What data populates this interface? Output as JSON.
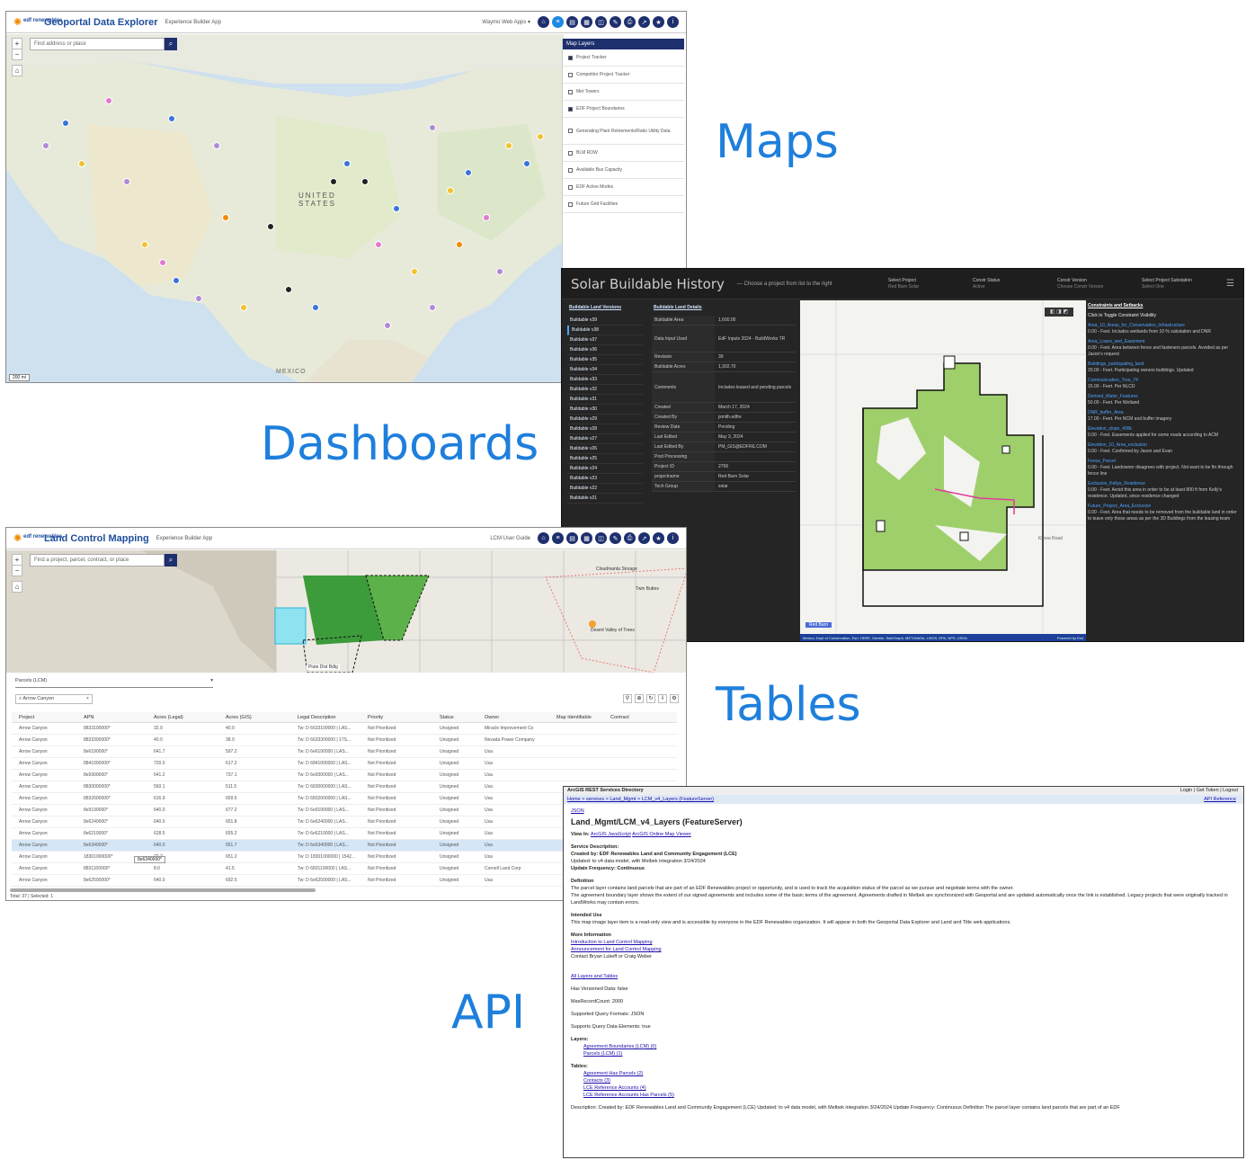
{
  "captions": {
    "maps": "Maps",
    "dashboards": "Dashboards",
    "tables": "Tables",
    "api": "API"
  },
  "geoportal": {
    "logo": "edf renewables",
    "title": "Geoportal Data Explorer",
    "subtitle": "Experience Builder App",
    "header_link": "Waymo Web Apps ▾",
    "search_placeholder": "Find address or place",
    "layers_title": "Map Layers",
    "layers": [
      "Project Tracker",
      "Competitor Project Tracker",
      "Met Towers",
      "EDF Project Boundaries",
      "Generating Plant Retirements/Ratio Utility Data",
      "BLM ROW",
      "Available Bus Capacity",
      "EDF Active Modes",
      "Future Grid Facilities"
    ],
    "scale": "200 mi"
  },
  "dashboard": {
    "title": "Solar Buildable History",
    "subtitle": "— Choose a project from list to the right",
    "selectors": [
      {
        "label": "Select Project",
        "value": "Red Barn Solar"
      },
      {
        "label": "Constr Status",
        "value": "Active"
      },
      {
        "label": "Constr Version",
        "value": "Choose Constr Version"
      },
      {
        "label": "Select Project Substation",
        "value": "Select One"
      }
    ],
    "list_header": "Buildable Land Versions",
    "versions": [
      "Buildable v39",
      "Buildable v38",
      "Buildable v37",
      "Buildable v36",
      "Buildable v35",
      "Buildable v34",
      "Buildable v33",
      "Buildable v32",
      "Buildable v31",
      "Buildable v30",
      "Buildable v29",
      "Buildable v28",
      "Buildable v27",
      "Buildable v26",
      "Buildable v25",
      "Buildable v24",
      "Buildable v23",
      "Buildable v22",
      "Buildable v21"
    ],
    "details_header": "Buildable Land Details",
    "details": [
      {
        "k": "Buildable Area",
        "v": "1,600.00"
      },
      {
        "k": "Data Input Used",
        "v": "EdF Inputs 2024 - BuildWorks TR"
      },
      {
        "k": "Revision",
        "v": "39"
      },
      {
        "k": "Buildable Acres",
        "v": "1,302.70"
      },
      {
        "k": "Comments",
        "v": "Includes leased and pending parcels"
      },
      {
        "k": "Created",
        "v": "March 17, 2024"
      },
      {
        "k": "Created By",
        "v": "jsmith.edfre"
      },
      {
        "k": "Review Date",
        "v": "Pending"
      },
      {
        "k": "Last Edited",
        "v": "May 3, 2024"
      },
      {
        "k": "Last Edited By",
        "v": "PM_GIS@EDFRE.COM"
      },
      {
        "k": "Post Processing",
        "v": ""
      },
      {
        "k": "Project ID",
        "v": "2796"
      },
      {
        "k": "projectname",
        "v": "Red Barn Solar"
      },
      {
        "k": "Tech Group",
        "v": "solar"
      }
    ],
    "constraints_header": "Constraints and Setbacks",
    "constraints_hint": "Click to Toggle Constraint Visibility",
    "constraints": [
      {
        "name": "Area_10_Areas_for_Conservation_Infrastructure",
        "note": "0.00 - Feet. Includes wetlands from 10 % substation and DNR"
      },
      {
        "name": "Area_Loans_and_Easement",
        "note": "0.00 - Feet. Area between fence and fasteners parcels. Avoided as per Jason's request"
      },
      {
        "name": "Buildings_participating_land",
        "note": "20.00 - Feet. Participating owners buildings. Updated"
      },
      {
        "name": "Communication_Tree_74",
        "note": "15.00 - Feet. Per NLCD"
      },
      {
        "name": "Derived_Water_Features",
        "note": "50.00 - Feet. Per Wetland"
      },
      {
        "name": "DNR_buffer_Area",
        "note": "17.00 - Feet. Per NCM and buffer imagery"
      },
      {
        "name": "Elevation_slope_400k",
        "note": "0.00 - Feet. Easements applied for some roads according to ACM"
      },
      {
        "name": "Elevation_10_Area_exclusion",
        "note": "0.00 - Feet. Confirmed by Jason and Evan"
      },
      {
        "name": "Fence_Parcel",
        "note": "0.00 - Feet. Landowner disagrees with project. Not want to be fin through fence line"
      },
      {
        "name": "Exclusion_Kellys_Residence",
        "note": "0.00 - Feet. Avoid this area in order to be at least 800 ft from Kelly's residence. Updated, since residence changed"
      },
      {
        "name": "Future_Project_Area_Exclusion",
        "note": "0.00 - Feet. Area that needs to be removed from the buildable land in order to leave only those areas as per the 3D Buildings from the leasing team"
      }
    ],
    "attribution": "Mexico, Dept of Conservation, Esri, HERE, Garmin, SafeGraph, METI/NASA, USGS, EPA, NPS, USDA",
    "powered": "Powered by Esri",
    "map_label_left": "Red Barn",
    "map_label_right": "Kiowa Road"
  },
  "lcm": {
    "logo": "edf renewables",
    "title": "Land Control Mapping",
    "subtitle": "Experience Builder App",
    "header_link": "LCM User Guide",
    "search_placeholder": "Find a project, parcel, contract, or place",
    "map_labels": [
      "Cloudmanta Storage",
      "Twin Buttes",
      "Desert Valley of Trees",
      "Piute Dist Bdlg"
    ],
    "layer_select": "Parcels (LCM)",
    "filter": "Arrow Canyon",
    "columns": [
      "Project",
      "APN",
      "Acres (Legal)",
      "Acres (GIS)",
      "Legal Description",
      "Priority",
      "Status",
      "Owner",
      "Map Identifiable",
      "Contract"
    ],
    "rows": [
      [
        "Arrow Canyon",
        "8833100000*",
        "32.9",
        "40.0",
        "Tw: D 6633100000 | LAS...",
        "Not Prioritized",
        "Unsigned",
        "Miracle Improvement Co",
        ""
      ],
      [
        "Arrow Canyon",
        "8833300000*",
        "40.0",
        "38.0",
        "Tw: D 6633300000 | 17S...",
        "Not Prioritized",
        "Unsigned",
        "Nevada Power Company",
        ""
      ],
      [
        "Arrow Canyon",
        "8e6190000*",
        "641.7",
        "597.2",
        "Tw: D 6e6190000 | LAS...",
        "Not Prioritized",
        "Unsigned",
        "Usa",
        ""
      ],
      [
        "Arrow Canyon",
        "8841000000*",
        "720.0",
        "617.2",
        "Tw: D 6841000000 | LAS...",
        "Not Prioritized",
        "Unsigned",
        "Usa",
        ""
      ],
      [
        "Arrow Canyon",
        "8e9300000*",
        "641.2",
        "737.1",
        "Tw: D 6e9300000 | LAS...",
        "Not Prioritized",
        "Unsigned",
        "Usa",
        ""
      ],
      [
        "Arrow Canyon",
        "8830000000*",
        "560.1",
        "511.5",
        "Tw: D 6830000000 | LAS...",
        "Not Prioritized",
        "Unsigned",
        "Usa",
        ""
      ],
      [
        "Arrow Canyon",
        "8832000000*",
        "616.9",
        "659.5",
        "Tw: D 6832000000 | LAS...",
        "Not Prioritized",
        "Unsigned",
        "Usa",
        ""
      ],
      [
        "Arrow Canyon",
        "8e9190000*",
        "640.0",
        "677.2",
        "Tw: D 6e9190000 | LAS...",
        "Not Prioritized",
        "Unsigned",
        "Usa",
        ""
      ],
      [
        "Arrow Canyon",
        "8e6240000*",
        "640.0",
        "651.8",
        "Tw: D 6e6240000 | LAS...",
        "Not Prioritized",
        "Unsigned",
        "Usa",
        ""
      ],
      [
        "Arrow Canyon",
        "8e6210000*",
        "628.5",
        "655.2",
        "Tw: D 6e6210000 | LAS...",
        "Not Prioritized",
        "Unsigned",
        "Usa",
        ""
      ],
      [
        "Arrow Canyon",
        "8e6340000*",
        "640.0",
        "651.7",
        "Tw: D 6e6340000 | LAS...",
        "Not Prioritized",
        "Unsigned",
        "Usa",
        ""
      ],
      [
        "Arrow Canyon",
        "18301000000*",
        "72.2",
        "651.2",
        "Tw: D 18301000000 | 1542...",
        "Not Prioritized",
        "Unsigned",
        "Usa",
        ""
      ],
      [
        "Arrow Canyon",
        "8831100000*",
        "8.0",
        "41.5",
        "Tw: D 6831100000 | LAS...",
        "Not Prioritized",
        "Unsigned",
        "Cornell Land Corp",
        ""
      ],
      [
        "Arrow Canyon",
        "8e62500000*",
        "640.0",
        "692.5",
        "Tw: D 6e62500000 | LAS...",
        "Not Prioritized",
        "Unsigned",
        "Usa",
        ""
      ]
    ],
    "tooltip": "8e6340000*",
    "footer": "Total: 37 | Selected: 1"
  },
  "api": {
    "header": "ArcGIS REST Services Directory",
    "login": "Login | Get Token | Logout",
    "breadcrumb": "Home > services > Land_Mgmt > LCM_v4_Layers (FeatureServer)",
    "api_ref": "API Reference",
    "json_link": "JSON",
    "title": "Land_Mgmt/LCM_v4_Layers (FeatureServer)",
    "view_in": "View In:",
    "view_links": [
      "ArcGIS JavaScript",
      "ArcGIS Online Map Viewer"
    ],
    "service_desc_label": "Service Description:",
    "created_by": "Created by: EDF Renewables Land and Community Engagement (LCE)",
    "updated": "Updated: to v4 data model, with Melbek integration 3/24/2024",
    "frequency": "Update Frequency: Continuous",
    "definition_label": "Definition",
    "definition": "The parcel layer contains land parcels that are part of an EDF Renewables project or opportunity, and is used to track the acquisition status of the parcel as we pursue and negotiate terms with the owner.",
    "definition2": "The agreement boundary layer shows the extent of our signed agreements and includes some of the basic terms of the agreement. Agreements drafted in Melbek are synchronized with Geoportal and are updated automatically once the link is established. Legacy projects that were originally tracked in LandWorks may contain errors.",
    "intended_label": "Intended Use",
    "intended": "This map image layer item is a read-only view and is accessible by everyone in the EDF Renewables organization. It will appear in both the Geoportal Data Explorer and Land and Title web applications.",
    "more_label": "More Information",
    "more_links": [
      "Introduction to Land Control Mapping",
      "Announcement for Land Control Mapping"
    ],
    "contact": "Contact Bryan Lukeff or Craig Weber",
    "all_layers": "All Layers and Tables",
    "versioned": "Has Versioned Data: false",
    "max_records": "MaxRecordCount: 2000",
    "formats": "Supported Query Formats: JSON",
    "query_elements": "Supports Query Data Elements: true",
    "layers_label": "Layers:",
    "layers": [
      "Agreement Boundaries (LCM) (0)",
      "Parcels (LCM) (1)"
    ],
    "tables_label": "Tables:",
    "tables": [
      "Agreement Has Parcels (2)",
      "Contacts (3)",
      "LCE Reference Accounts (4)",
      "LCE Reference Accounts Has Parcels (5)"
    ],
    "description": "Description: Created by: EDF Renewables Land and Community Engagement (LCE) Updated: to v4 data model, with Melbek integration 3/24/2024 Update Frequency: Continuous Definition The parcel layer contains land parcels that are part of an EDF"
  }
}
